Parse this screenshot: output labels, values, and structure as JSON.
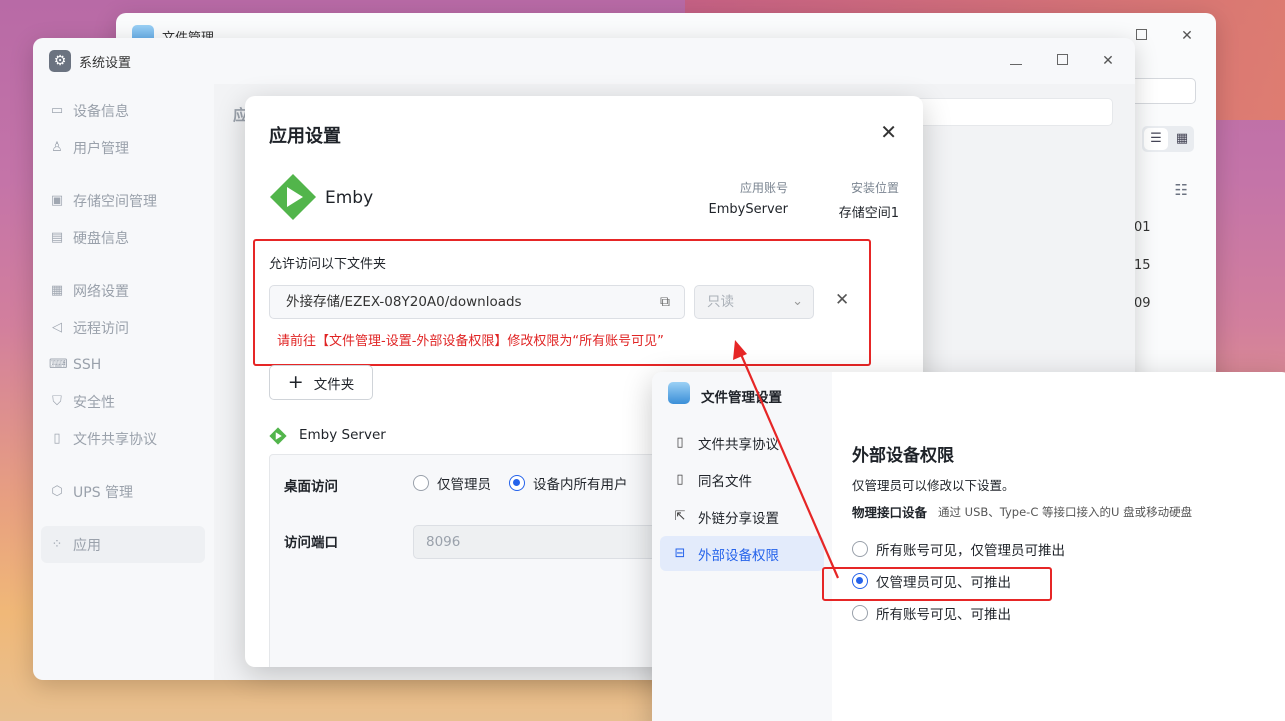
{
  "file_manager_window": {
    "title": "文件管理",
    "row_numbers": [
      "01",
      "15",
      "09"
    ]
  },
  "system_settings_window": {
    "title": "系统设置",
    "section_title": "应",
    "sidebar": [
      {
        "label": "设备信息",
        "icon": "info-icon"
      },
      {
        "label": "用户管理",
        "icon": "user-icon"
      },
      {
        "label": "存储空间管理",
        "icon": "storage-icon"
      },
      {
        "label": "硬盘信息",
        "icon": "disk-icon"
      },
      {
        "label": "网络设置",
        "icon": "network-icon"
      },
      {
        "label": "远程访问",
        "icon": "remote-icon"
      },
      {
        "label": "SSH",
        "icon": "ssh-icon"
      },
      {
        "label": "安全性",
        "icon": "shield-icon"
      },
      {
        "label": "文件共享协议",
        "icon": "share-icon"
      },
      {
        "label": "UPS 管理",
        "icon": "ups-icon"
      },
      {
        "label": "应用",
        "icon": "apps-icon",
        "active": true
      }
    ]
  },
  "app_settings_dialog": {
    "title": "应用设置",
    "close": "✕",
    "app_name": "Emby",
    "account_label": "应用账号",
    "account_value": "EmbyServer",
    "location_label": "安装位置",
    "location_value": "存储空间1",
    "folders_label": "允许访问以下文件夹",
    "folder_path": "外接存储/EZEX-08Y20A0/downloads",
    "folder_permission": "只读",
    "warning": "请前往【文件管理-设置-外部设备权限】修改权限为“所有账号可见”",
    "add_folder": "文件夹",
    "service_name": "Emby Server",
    "desktop_access_label": "桌面访问",
    "desktop_access_options": [
      {
        "label": "仅管理员",
        "selected": false
      },
      {
        "label": "设备内所有用户",
        "selected": true
      }
    ],
    "port_label": "访问端口",
    "port_value": "8096"
  },
  "file_settings_window": {
    "title": "文件管理设置",
    "sidebar": [
      {
        "label": "文件共享协议",
        "icon": "share-icon"
      },
      {
        "label": "同名文件",
        "icon": "file-icon"
      },
      {
        "label": "外链分享设置",
        "icon": "external-link-icon"
      },
      {
        "label": "外部设备权限",
        "icon": "drive-icon",
        "active": true
      }
    ],
    "heading": "外部设备权限",
    "note": "仅管理员可以修改以下设置。",
    "subheading": "物理接口设备",
    "subheading_desc": "通过 USB、Type-C 等接口接入的U 盘或移动硬盘",
    "options": [
      {
        "label": "所有账号可见，仅管理员可推出",
        "selected": false
      },
      {
        "label": "仅管理员可见、可推出",
        "selected": true
      },
      {
        "label": "所有账号可见、可推出",
        "selected": false
      }
    ]
  },
  "colors": {
    "accent": "#2563eb",
    "warning": "#e02424",
    "emby_green": "#52b54b"
  }
}
